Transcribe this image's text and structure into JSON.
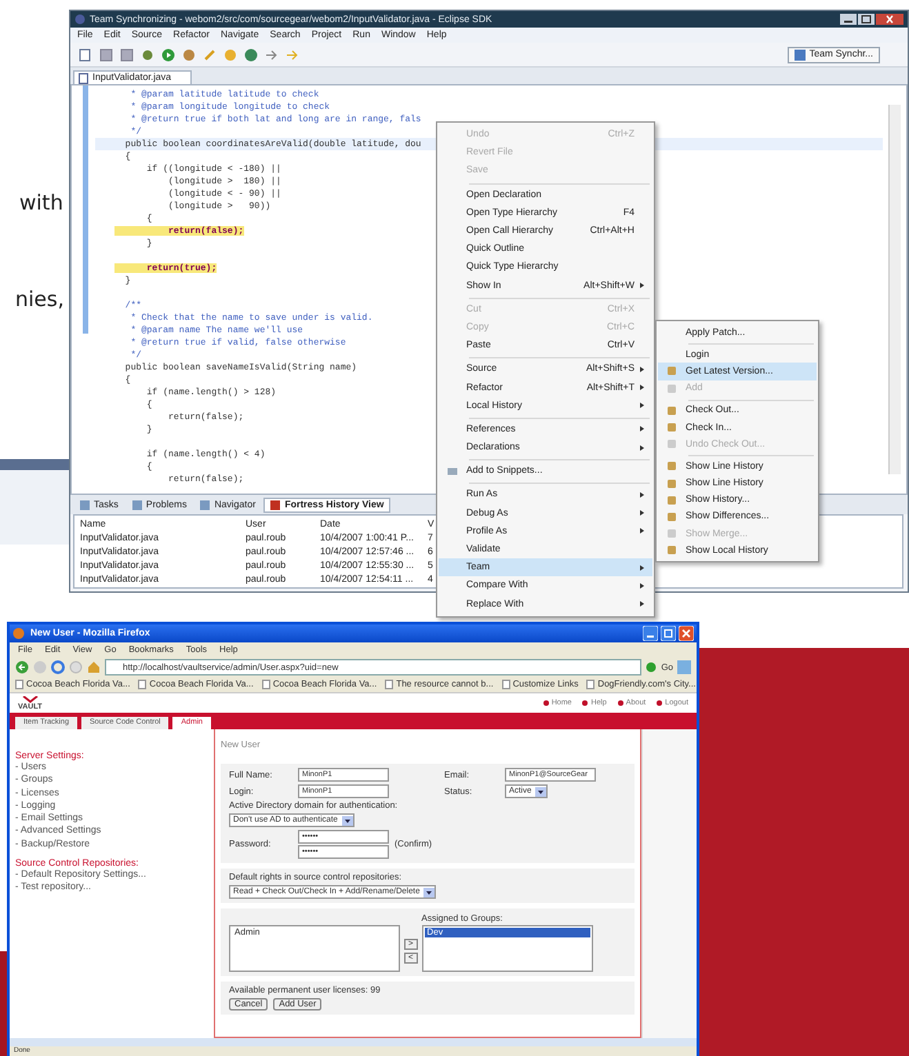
{
  "page_fragments": [
    "with",
    "nies,"
  ],
  "eclipse": {
    "title": "Team Synchronizing - webom2/src/com/sourcegear/webom2/InputValidator.java - Eclipse SDK",
    "menu": [
      "File",
      "Edit",
      "Source",
      "Refactor",
      "Navigate",
      "Search",
      "Project",
      "Run",
      "Window",
      "Help"
    ],
    "perspective": "Team Synchr...",
    "editor_tab": "InputValidator.java",
    "code": [
      {
        "kind": "comment",
        "text": "   * @param latitude latitude to check",
        "highlighted": false,
        "current": false
      },
      {
        "kind": "comment",
        "text": "   * @param longitude longitude to check",
        "highlighted": false,
        "current": false
      },
      {
        "kind": "comment",
        "text": "   * @return true if both lat and long are in range, fals",
        "highlighted": false,
        "current": false
      },
      {
        "kind": "comment",
        "text": "   */",
        "highlighted": false,
        "current": false
      },
      {
        "kind": "code",
        "text": "  public boolean coordinatesAreValid(double latitude, dou",
        "highlighted": false,
        "current": true
      },
      {
        "kind": "code",
        "text": "  {",
        "highlighted": false,
        "current": false
      },
      {
        "kind": "code",
        "text": "      if ((longitude < -180) ||",
        "highlighted": false,
        "current": false
      },
      {
        "kind": "code",
        "text": "          (longitude >  180) ||",
        "highlighted": false,
        "current": false
      },
      {
        "kind": "code",
        "text": "          (longitude < - 90) ||",
        "highlighted": false,
        "current": false
      },
      {
        "kind": "code",
        "text": "          (longitude >   90))",
        "highlighted": false,
        "current": false
      },
      {
        "kind": "code",
        "text": "      {",
        "highlighted": false,
        "current": false
      },
      {
        "kind": "code",
        "text": "          return(false);",
        "highlighted": true,
        "current": false
      },
      {
        "kind": "code",
        "text": "      }",
        "highlighted": false,
        "current": false
      },
      {
        "kind": "blank",
        "highlighted": false,
        "current": false
      },
      {
        "kind": "code",
        "text": "      return(true);",
        "highlighted": true,
        "current": false
      },
      {
        "kind": "code",
        "text": "  }",
        "highlighted": false,
        "current": false
      },
      {
        "kind": "blank",
        "highlighted": false,
        "current": false
      },
      {
        "kind": "comment",
        "text": "  /**",
        "highlighted": false,
        "current": false
      },
      {
        "kind": "comment",
        "text": "   * Check that the name to save under is valid.",
        "highlighted": false,
        "current": false
      },
      {
        "kind": "comment",
        "text": "   * @param name The name we'll use",
        "highlighted": false,
        "current": false
      },
      {
        "kind": "comment",
        "text": "   * @return true if valid, false otherwise",
        "highlighted": false,
        "current": false
      },
      {
        "kind": "comment",
        "text": "   */",
        "highlighted": false,
        "current": false
      },
      {
        "kind": "code",
        "text": "  public boolean saveNameIsValid(String name)",
        "highlighted": false,
        "current": false
      },
      {
        "kind": "code",
        "text": "  {",
        "highlighted": false,
        "current": false
      },
      {
        "kind": "code",
        "text": "      if (name.length() > 128)",
        "highlighted": false,
        "current": false
      },
      {
        "kind": "code",
        "text": "      {",
        "highlighted": false,
        "current": false
      },
      {
        "kind": "code",
        "text": "          return(false);",
        "highlighted": false,
        "current": false
      },
      {
        "kind": "code",
        "text": "      }",
        "highlighted": false,
        "current": false
      },
      {
        "kind": "blank",
        "highlighted": false,
        "current": false
      },
      {
        "kind": "code",
        "text": "      if (name.length() < 4)",
        "highlighted": false,
        "current": false
      },
      {
        "kind": "code",
        "text": "      {",
        "highlighted": false,
        "current": false
      },
      {
        "kind": "code",
        "text": "          return(false);",
        "highlighted": false,
        "current": false
      }
    ],
    "view_tabs": [
      {
        "label": "Tasks",
        "selected": false
      },
      {
        "label": "Problems",
        "selected": false
      },
      {
        "label": "Navigator",
        "selected": false
      },
      {
        "label": "Fortress History View",
        "selected": true
      }
    ],
    "history_table": {
      "columns": [
        "Name",
        "User",
        "Date",
        "V"
      ],
      "rows": [
        [
          "InputValidator.java",
          "paul.roub",
          "10/4/2007 1:00:41 P...",
          "7"
        ],
        [
          "InputValidator.java",
          "paul.roub",
          "10/4/2007 12:57:46 ...",
          "6"
        ],
        [
          "InputValidator.java",
          "paul.roub",
          "10/4/2007 12:55:30 ...",
          "5"
        ],
        [
          "InputValidator.java",
          "paul.roub",
          "10/4/2007 12:54:11 ...",
          "4"
        ]
      ]
    }
  },
  "context_menu": {
    "items": [
      {
        "kind": "item",
        "label": "Undo",
        "shortcut": "Ctrl+Z",
        "disabled": true,
        "submenu": false,
        "selected": false
      },
      {
        "kind": "item",
        "label": "Revert File",
        "disabled": true,
        "submenu": false,
        "selected": false
      },
      {
        "kind": "item",
        "label": "Save",
        "disabled": true,
        "submenu": false,
        "selected": false
      },
      {
        "kind": "separator"
      },
      {
        "kind": "item",
        "label": "Open Declaration",
        "disabled": false,
        "submenu": false,
        "selected": false
      },
      {
        "kind": "item",
        "label": "Open Type Hierarchy",
        "shortcut": "F4",
        "disabled": false,
        "submenu": false,
        "selected": false
      },
      {
        "kind": "item",
        "label": "Open Call Hierarchy",
        "shortcut": "Ctrl+Alt+H",
        "disabled": false,
        "submenu": false,
        "selected": false
      },
      {
        "kind": "item",
        "label": "Quick Outline",
        "disabled": false,
        "submenu": false,
        "selected": false
      },
      {
        "kind": "item",
        "label": "Quick Type Hierarchy",
        "disabled": false,
        "submenu": false,
        "selected": false
      },
      {
        "kind": "item",
        "label": "Show In",
        "shortcut": "Alt+Shift+W",
        "disabled": false,
        "submenu": true,
        "selected": false
      },
      {
        "kind": "separator"
      },
      {
        "kind": "item",
        "label": "Cut",
        "shortcut": "Ctrl+X",
        "disabled": true,
        "submenu": false,
        "selected": false
      },
      {
        "kind": "item",
        "label": "Copy",
        "shortcut": "Ctrl+C",
        "disabled": true,
        "submenu": false,
        "selected": false
      },
      {
        "kind": "item",
        "label": "Paste",
        "shortcut": "Ctrl+V",
        "disabled": false,
        "submenu": false,
        "selected": false
      },
      {
        "kind": "separator"
      },
      {
        "kind": "item",
        "label": "Source",
        "shortcut": "Alt+Shift+S",
        "disabled": false,
        "submenu": true,
        "selected": false
      },
      {
        "kind": "item",
        "label": "Refactor",
        "shortcut": "Alt+Shift+T",
        "disabled": false,
        "submenu": true,
        "selected": false
      },
      {
        "kind": "item",
        "label": "Local History",
        "disabled": false,
        "submenu": true,
        "selected": false
      },
      {
        "kind": "separator"
      },
      {
        "kind": "item",
        "label": "References",
        "disabled": false,
        "submenu": true,
        "selected": false
      },
      {
        "kind": "item",
        "label": "Declarations",
        "disabled": false,
        "submenu": true,
        "selected": false
      },
      {
        "kind": "separator"
      },
      {
        "kind": "item",
        "label": "Add to Snippets...",
        "disabled": false,
        "submenu": false,
        "selected": false
      },
      {
        "kind": "separator"
      },
      {
        "kind": "item",
        "label": "Run As",
        "disabled": false,
        "submenu": true,
        "selected": false
      },
      {
        "kind": "item",
        "label": "Debug As",
        "disabled": false,
        "submenu": true,
        "selected": false
      },
      {
        "kind": "item",
        "label": "Profile As",
        "disabled": false,
        "submenu": true,
        "selected": false
      },
      {
        "kind": "item",
        "label": "Validate",
        "disabled": false,
        "submenu": false,
        "selected": false
      },
      {
        "kind": "item",
        "label": "Team",
        "disabled": false,
        "submenu": true,
        "selected": true
      },
      {
        "kind": "item",
        "label": "Compare With",
        "disabled": false,
        "submenu": true,
        "selected": false
      },
      {
        "kind": "item",
        "label": "Replace With",
        "disabled": false,
        "submenu": true,
        "selected": false
      }
    ]
  },
  "team_submenu": {
    "items": [
      {
        "kind": "item",
        "label": "Apply Patch...",
        "disabled": false,
        "selected": false
      },
      {
        "kind": "separator"
      },
      {
        "kind": "item",
        "label": "Login",
        "disabled": false,
        "selected": false
      },
      {
        "kind": "item",
        "label": "Get Latest Version...",
        "disabled": false,
        "selected": true
      },
      {
        "kind": "item",
        "label": "Add",
        "disabled": true,
        "selected": false
      },
      {
        "kind": "separator"
      },
      {
        "kind": "item",
        "label": "Check Out...",
        "disabled": false,
        "selected": false
      },
      {
        "kind": "item",
        "label": "Check In...",
        "disabled": false,
        "selected": false
      },
      {
        "kind": "item",
        "label": "Undo Check Out...",
        "disabled": true,
        "selected": false
      },
      {
        "kind": "separator"
      },
      {
        "kind": "item",
        "label": "Show Line History",
        "disabled": false,
        "selected": false
      },
      {
        "kind": "item",
        "label": "Show Line History",
        "disabled": false,
        "selected": false
      },
      {
        "kind": "item",
        "label": "Show History...",
        "disabled": false,
        "selected": false
      },
      {
        "kind": "item",
        "label": "Show Differences...",
        "disabled": false,
        "selected": false
      },
      {
        "kind": "item",
        "label": "Show Merge...",
        "disabled": true,
        "selected": false
      },
      {
        "kind": "item",
        "label": "Show Local History",
        "disabled": false,
        "selected": false
      }
    ]
  },
  "firefox": {
    "title": "New User - Mozilla Firefox",
    "menu": [
      "File",
      "Edit",
      "View",
      "Go",
      "Bookmarks",
      "Tools",
      "Help"
    ],
    "url": "http://localhost/vaultservice/admin/User.aspx?uid=new",
    "go": "Go",
    "bookmarks": [
      "Cocoa Beach Florida Va...",
      "Cocoa Beach Florida Va...",
      "Cocoa Beach Florida Va...",
      "The resource cannot b...",
      "Customize Links",
      "DogFriendly.com's City..."
    ],
    "logo": "VAULT",
    "header_links": [
      "Home",
      "Help",
      "About",
      "Logout"
    ],
    "tabs": [
      {
        "label": "Item Tracking",
        "selected": false
      },
      {
        "label": "Source Code Control",
        "selected": false
      },
      {
        "label": "Admin",
        "selected": true
      }
    ],
    "sidebar": [
      {
        "heading": "Server Settings:",
        "items": [
          "- Users",
          "- Groups",
          "- Licenses",
          "- Logging",
          "- Email Settings",
          "- Advanced Settings",
          "- Backup/Restore"
        ]
      },
      {
        "heading": "Source Control Repositories:",
        "items": [
          "- Default Repository Settings...",
          "- Test repository..."
        ]
      }
    ],
    "form": {
      "heading": "New User",
      "full_name_label": "Full Name:",
      "full_name": "MinonP1",
      "email_label": "Email:",
      "email": "MinonP1@SourceGear",
      "login_label": "Login:",
      "login": "MinonP1",
      "status_label": "Status:",
      "status": "Active",
      "ad_label": "Active Directory domain for authentication:",
      "ad_value": "Don't use AD to authenticate",
      "password_label": "Password:",
      "password": "••••••",
      "confirm_password": "••••••",
      "confirm_label": "(Confirm)",
      "rights_label": "Default rights in source control repositories:",
      "rights_value": "Read + Check Out/Check In + Add/Rename/Delete",
      "available_groups": [
        {
          "label": "Admin",
          "selected": false
        }
      ],
      "add_button": ">",
      "remove_button": "<",
      "assigned_label": "Assigned to Groups:",
      "assigned_groups": [
        {
          "label": "Dev",
          "selected": true
        }
      ],
      "licenses": "Available permanent user licenses: 99",
      "buttons": [
        "Cancel",
        "Add User"
      ]
    },
    "status_bar": "Done"
  }
}
